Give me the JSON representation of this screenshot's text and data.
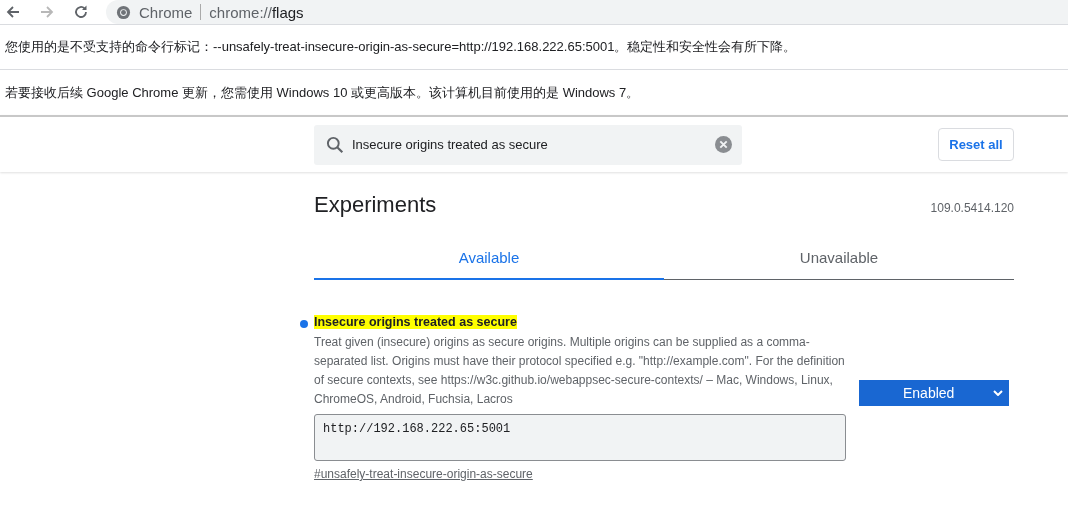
{
  "toolbar": {
    "back": {
      "disabled": false
    },
    "forward": {
      "disabled": true
    }
  },
  "address_bar": {
    "site_label": "Chrome",
    "url_host": "chrome://",
    "url_path": "flags"
  },
  "infobars": [
    {
      "text": "您使用的是不受支持的命令行标记：--unsafely-treat-insecure-origin-as-secure=http://192.168.222.65:5001。稳定性和安全性会有所下降。"
    },
    {
      "text": "若要接收后续 Google Chrome 更新，您需使用 Windows 10 或更高版本。该计算机目前使用的是 Windows 7。"
    }
  ],
  "search": {
    "value": "Insecure origins treated as secure"
  },
  "reset_button": "Reset all",
  "title": "Experiments",
  "version": "109.0.5414.120",
  "tabs": [
    {
      "label": "Available",
      "selected": true
    },
    {
      "label": "Unavailable",
      "selected": false
    }
  ],
  "flags": [
    {
      "name": "Insecure origins treated as secure",
      "highlighted": true,
      "modified": true,
      "description": "Treat given (insecure) origins as secure origins. Multiple origins can be supplied as a comma-separated list. Origins must have their protocol specified e.g. \"http://example.com\". For the definition of secure contexts, see https://w3c.github.io/webappsec-secure-contexts/ – Mac, Windows, Linux, ChromeOS, Android, Fuchsia, Lacros",
      "value": "http://192.168.222.65:5001",
      "link": "#unsafely-treat-insecure-origin-as-secure",
      "select": {
        "value": "Enabled"
      }
    }
  ]
}
